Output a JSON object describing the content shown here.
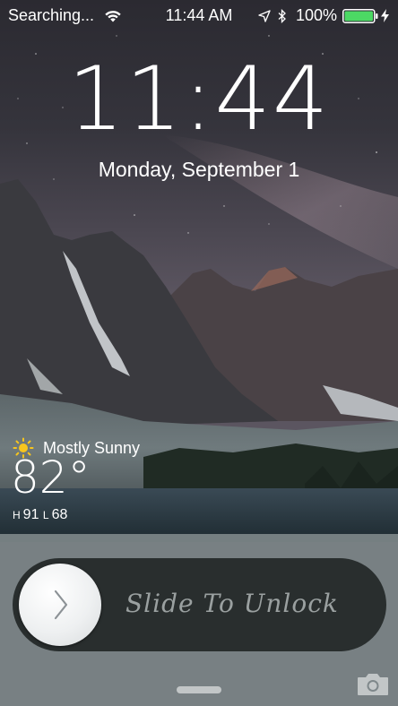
{
  "status_bar": {
    "carrier": "Searching...",
    "time": "11:44 AM",
    "battery_percent": "100%",
    "icons": [
      "wifi-icon",
      "location-arrow-icon",
      "bluetooth-icon",
      "battery-icon",
      "charging-bolt-icon"
    ]
  },
  "clock": {
    "time": "11:44",
    "date": "Monday, September 1"
  },
  "weather": {
    "icon": "sun-icon",
    "condition": "Mostly Sunny",
    "temperature": "82°",
    "high_label": "H",
    "high": "91",
    "low_label": "L",
    "low": "68"
  },
  "unlock": {
    "label": "Slide To Unlock",
    "knob_icon": "chevron-right-icon"
  },
  "bottom": {
    "camera_icon": "camera-icon",
    "grabber_icon": "grabber-icon"
  },
  "colors": {
    "battery_fill": "#4cd964",
    "sun": "#f7c51e",
    "unlock_text": "#9aa0a0"
  }
}
